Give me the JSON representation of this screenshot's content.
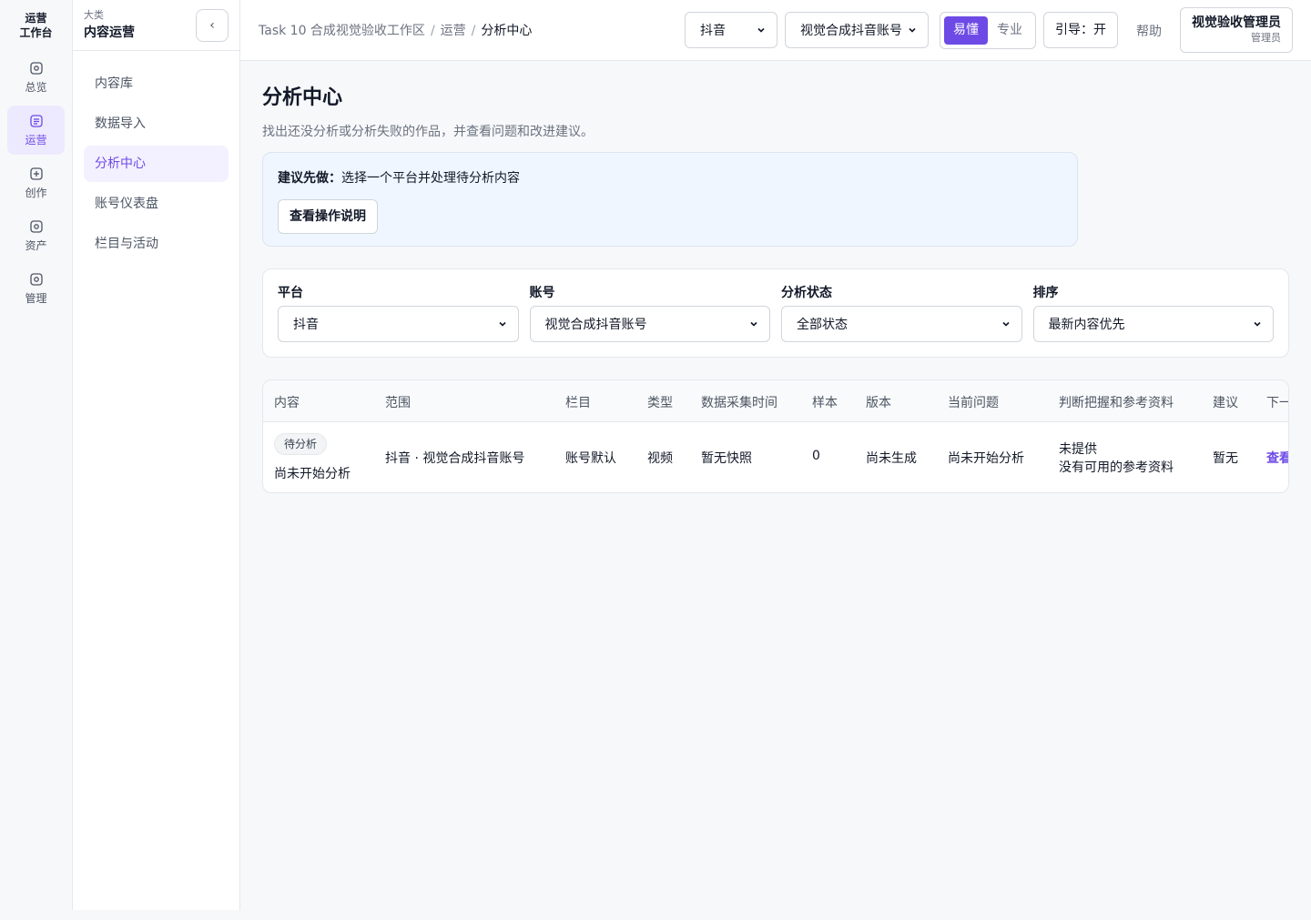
{
  "rail": {
    "title_line1": "运营",
    "title_line2": "工作台",
    "items": [
      {
        "label": "总览",
        "icon": "dashboard-icon"
      },
      {
        "label": "运营",
        "icon": "document-icon"
      },
      {
        "label": "创作",
        "icon": "plus-square-icon"
      },
      {
        "label": "资产",
        "icon": "asset-icon"
      },
      {
        "label": "管理",
        "icon": "admin-icon"
      }
    ]
  },
  "subbar": {
    "category_label": "大类",
    "category_name": "内容运营",
    "collapse_icon": "‹",
    "items": [
      "内容库",
      "数据导入",
      "分析中心",
      "账号仪表盘",
      "栏目与活动"
    ]
  },
  "topbar": {
    "breadcrumb": [
      "Task 10 合成视觉验收工作区",
      "运营",
      "分析中心"
    ],
    "platform_select": "抖音",
    "account_select": "视觉合成抖音账号",
    "mode_easy": "易懂",
    "mode_pro": "专业",
    "guide": "引导：开",
    "help": "帮助",
    "user_name": "视觉验收管理员",
    "user_role": "管理员"
  },
  "page": {
    "title": "分析中心",
    "description": "找出还没分析或分析失败的作品，并查看问题和改进建议。",
    "tip_label": "建议先做：",
    "tip_text": "选择一个平台并处理待分析内容",
    "tip_button": "查看操作说明"
  },
  "filters": [
    {
      "label": "平台",
      "value": "抖音"
    },
    {
      "label": "账号",
      "value": "视觉合成抖音账号"
    },
    {
      "label": "分析状态",
      "value": "全部状态"
    },
    {
      "label": "排序",
      "value": "最新内容优先"
    }
  ],
  "table": {
    "headers": [
      "内容",
      "范围",
      "栏目",
      "类型",
      "数据采集时间",
      "样本",
      "版本",
      "当前问题",
      "判断把握和参考资料",
      "建议",
      "下一"
    ],
    "rows": [
      {
        "badge": "待分析",
        "content": "尚未开始分析",
        "scope": "抖音 · 视觉合成抖音账号",
        "column": "账号默认",
        "type": "视频",
        "collected": "暂无快照",
        "samples": "0",
        "version": "尚未生成",
        "issue": "尚未开始分析",
        "confidence_line1": "未提供",
        "confidence_line2": "没有可用的参考资料",
        "advice": "暂无",
        "next": "查看"
      }
    ]
  },
  "colors": {
    "accent": "#6d4ae6",
    "accent_soft": "#ede9fe",
    "tip_bg": "#eff6ff"
  }
}
